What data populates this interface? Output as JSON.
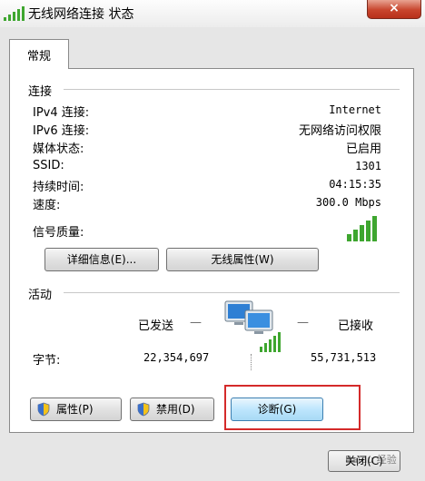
{
  "window": {
    "title": "无线网络连接 状态",
    "close_glyph": "×"
  },
  "tabs": [
    {
      "label": "常规"
    }
  ],
  "connection": {
    "heading": "连接",
    "rows": [
      {
        "label": "IPv4 连接:",
        "value": "Internet"
      },
      {
        "label": "IPv6 连接:",
        "value": "无网络访问权限"
      },
      {
        "label": "媒体状态:",
        "value": "已启用"
      },
      {
        "label": "SSID:",
        "value": "1301"
      },
      {
        "label": "持续时间:",
        "value": "04:15:35"
      },
      {
        "label": "速度:",
        "value": "300.0 Mbps"
      }
    ],
    "signal_label": "信号质量:",
    "signal_bars": 5,
    "signal_max": 5,
    "details_button": "详细信息(E)...",
    "wireless_properties_button": "无线属性(W)"
  },
  "activity": {
    "heading": "活动",
    "sent_label": "已发送",
    "received_label": "已接收",
    "dash": "—",
    "bytes_label": "字节:",
    "bytes_sent": "22,354,697",
    "bytes_received": "55,731,513"
  },
  "buttons": {
    "properties": "属性(P)",
    "disable": "禁用(D)",
    "diagnose": "诊断(G)",
    "close": "关闭(C)"
  },
  "watermark": "Baidu 经验",
  "colors": {
    "signal_green": "#3ea62f",
    "highlight_red": "#d42a2a",
    "close_red": "#c8452d"
  }
}
